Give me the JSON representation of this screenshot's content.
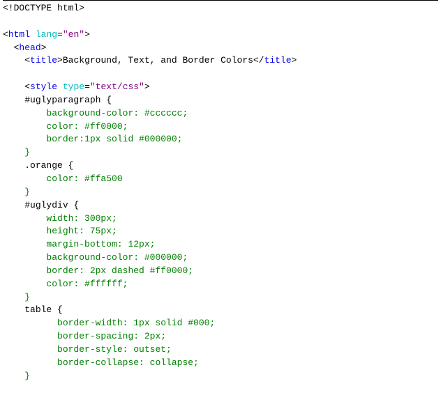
{
  "code": {
    "doctype": "<!DOCTYPE html>",
    "html_open_tag": "html",
    "html_lang_attr": "lang",
    "html_lang_val": "\"en\"",
    "head_open": "head",
    "title_tag": "title",
    "title_text": "Background, Text, and Border Colors",
    "style_tag": "style",
    "style_type_attr": "type",
    "style_type_val": "\"text/css\"",
    "rule1_selector": "#uglyparagraph {",
    "rule1_line1": "    background-color: #cccccc;",
    "rule1_line2": "    color: #ff0000;",
    "rule1_line3": "    border:1px solid #000000;",
    "rule1_close": "}",
    "rule2_selector": ".orange {",
    "rule2_line1": "    color: #ffa500",
    "rule2_close": "}",
    "rule3_selector": "#uglydiv {",
    "rule3_line1": "    width: 300px;",
    "rule3_line2": "    height: 75px;",
    "rule3_line3": "    margin-bottom: 12px;",
    "rule3_line4": "    background-color: #000000;",
    "rule3_line5": "    border: 2px dashed #ff0000;",
    "rule3_line6": "    color: #ffffff;",
    "rule3_close": "}",
    "rule4_selector": "table {",
    "rule4_line1": "      border-width: 1px solid #000;",
    "rule4_line2": "      border-spacing: 2px;",
    "rule4_line3": "      border-style: outset;",
    "rule4_line4": "      border-collapse: collapse;",
    "rule4_close": "}"
  }
}
